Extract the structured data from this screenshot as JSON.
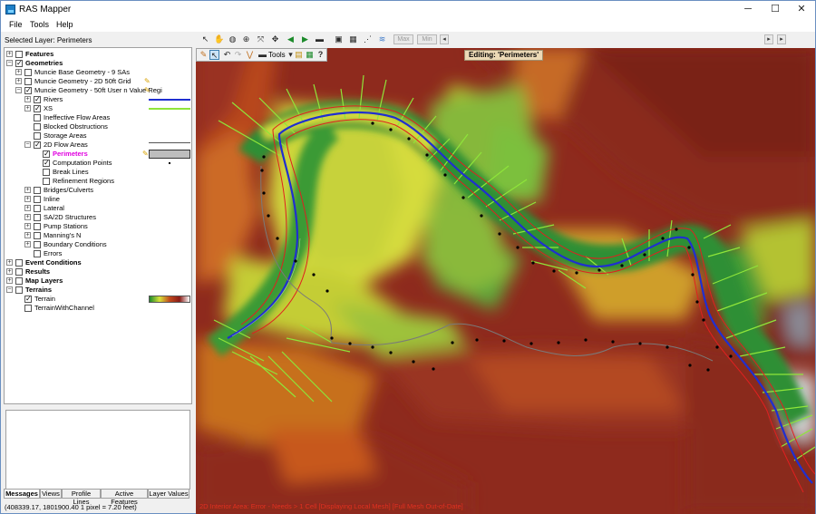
{
  "window": {
    "title": "RAS Mapper",
    "minimize": "─",
    "maximize": "☐",
    "close": "✕"
  },
  "menu": [
    "File",
    "Tools",
    "Help"
  ],
  "selected_layer": "Selected Layer: Perimeters",
  "tree": {
    "features": "Features",
    "geometries": "Geometries",
    "geo1": "Muncie Base Geometry - 9 SAs",
    "geo2": "Muncie Geometry - 2D 50ft Grid",
    "geo3": "Muncie Geometry - 50ft User n Value Regi",
    "rivers": "Rivers",
    "xs": "XS",
    "ineffective": "Ineffective Flow Areas",
    "blocked": "Blocked Obstructions",
    "storage": "Storage Areas",
    "flow2d": "2D Flow Areas",
    "perimeters": "Perimeters",
    "computation_points": "Computation Points",
    "break_lines": "Break Lines",
    "refinement": "Refinement Regions",
    "bridges": "Bridges/Culverts",
    "inline": "Inline",
    "lateral": "Lateral",
    "sa2d": "SA/2D Structures",
    "pumps": "Pump Stations",
    "mannings": "Manning's N",
    "boundary": "Boundary Conditions",
    "errors": "Errors",
    "event_conditions": "Event Conditions",
    "results": "Results",
    "map_layers": "Map Layers",
    "terrains": "Terrains",
    "terrain": "Terrain",
    "terrain_channel": "TerrainWithChannel"
  },
  "bottom_tabs": [
    "Messages",
    "Views",
    "Profile Lines",
    "Active Features",
    "Layer Values"
  ],
  "coords_text": "(408339.17, 1801900.40  1 pixel = 7.20 feet)",
  "toolbar": {
    "max_label": "Max",
    "min_label": "Min",
    "edit_tools": "Tools",
    "help": "?"
  },
  "editing_badge": "Editing: 'Perimeters'",
  "status_text": "2D Interior Area: Error - Needs > 1 Cell   [Displaying Local Mesh]   [Full Mesh Out-of-Date]",
  "colors": {
    "river": "#1f2fd0",
    "xs": "#8fe53a",
    "perimeter": "#e02020",
    "accent_title": "#e000e0",
    "status_error": "#e03020"
  }
}
